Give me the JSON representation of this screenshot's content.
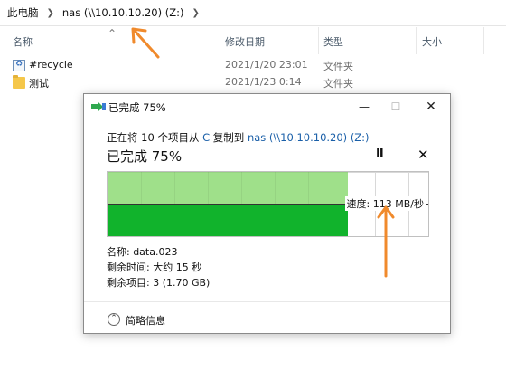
{
  "breadcrumb": {
    "items": [
      "此电脑",
      "nas (\\\\10.10.10.20) (Z:)"
    ]
  },
  "columns": {
    "name": "名称",
    "date": "修改日期",
    "type": "类型",
    "size": "大小"
  },
  "files": [
    {
      "name": "#recycle",
      "date": "2021/1/20 23:01",
      "type": "文件夹",
      "icon": "recycle-folder-icon"
    },
    {
      "name": "测试",
      "date": "2021/1/23 0:14",
      "type": "文件夹",
      "icon": "folder-icon"
    }
  ],
  "dialog": {
    "title": "已完成 75%",
    "copy_prefix": "正在将 10 个项目从 ",
    "source": "C",
    "copy_middle": " 复制到 ",
    "destination": "nas (\\\\10.10.10.20) (Z:)",
    "progress_title": "已完成 75%",
    "progress_percent": 75,
    "speed_label": "速度: 113 MB/秒",
    "details": {
      "name_line": "名称: data.023",
      "time_line": "剩余时间: 大约 15 秒",
      "items_line": "剩余项目: 3 (1.70 GB)"
    },
    "collapse_label": "简略信息",
    "pause_glyph": "II",
    "cancel_glyph": "✕",
    "window_buttons": {
      "min": "—",
      "max": "☐",
      "close": "✕"
    }
  },
  "colors": {
    "accent": "#1a5fa8",
    "graph_done": "#9fe08a",
    "speed_fill": "#11b32c",
    "arrow": "#f08a2c"
  }
}
